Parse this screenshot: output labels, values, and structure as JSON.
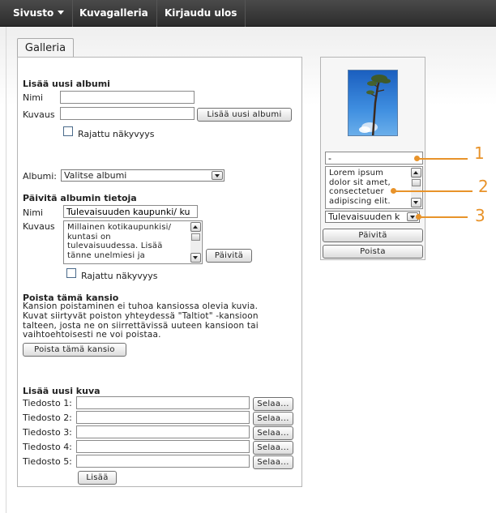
{
  "nav": {
    "items": [
      "Sivusto",
      "Kuvagalleria",
      "Kirjaudu ulos"
    ]
  },
  "tab": {
    "label": "Galleria"
  },
  "new_album": {
    "heading": "Lisää uusi albumi",
    "name_label": "Nimi",
    "name_value": "",
    "desc_label": "Kuvaus",
    "desc_value": "",
    "add_button": "Lisää uusi albumi",
    "restricted_label": "Rajattu näkyvyys"
  },
  "album_select": {
    "label": "Albumi:",
    "value": "Valitse albumi"
  },
  "update_album": {
    "heading": "Päivitä albumin tietoja",
    "name_label": "Nimi",
    "name_value": "Tulevaisuuden kaupunki/ ku",
    "desc_label": "Kuvaus",
    "desc_lines": [
      "Millainen kotikaupunkisi/",
      "kuntasi on",
      "tulevaisuudessa. Lisää",
      "tänne unelmiesi ja"
    ],
    "update_button": "Päivitä",
    "restricted_label": "Rajattu näkyvyys"
  },
  "delete_folder": {
    "heading": "Poista tämä kansio",
    "text_lines": [
      "Kansion poistaminen ei tuhoa kansiossa olevia kuvia.",
      "Kuvat siirtyvät poiston yhteydessä \"Taltiot\" -kansioon",
      "talteen, josta ne on siirrettävissä uuteen kansioon tai",
      "vaihtoehtoisesti ne voi poistaa."
    ],
    "button": "Poista tämä kansio"
  },
  "new_image": {
    "heading": "Lisää uusi kuva",
    "files": [
      {
        "label": "Tiedosto 1:",
        "value": "",
        "browse": "Selaa..."
      },
      {
        "label": "Tiedosto 2:",
        "value": "",
        "browse": "Selaa..."
      },
      {
        "label": "Tiedosto 3:",
        "value": "",
        "browse": "Selaa..."
      },
      {
        "label": "Tiedosto 4:",
        "value": "",
        "browse": "Selaa..."
      },
      {
        "label": "Tiedosto 5:",
        "value": "",
        "browse": "Selaa..."
      }
    ],
    "add_button": "Lisää"
  },
  "image_card": {
    "title_value": "-",
    "desc_lines": [
      "Lorem ipsum",
      "dolor sit amet,",
      "consectetuer",
      "adipiscing elit."
    ],
    "album_value": "Tulevaisuuden k",
    "update_button": "Päivitä",
    "delete_button": "Poista"
  },
  "callouts": [
    "1",
    "2",
    "3"
  ],
  "colors": {
    "nav_bg": "#333333",
    "callout": "#e8932a"
  }
}
